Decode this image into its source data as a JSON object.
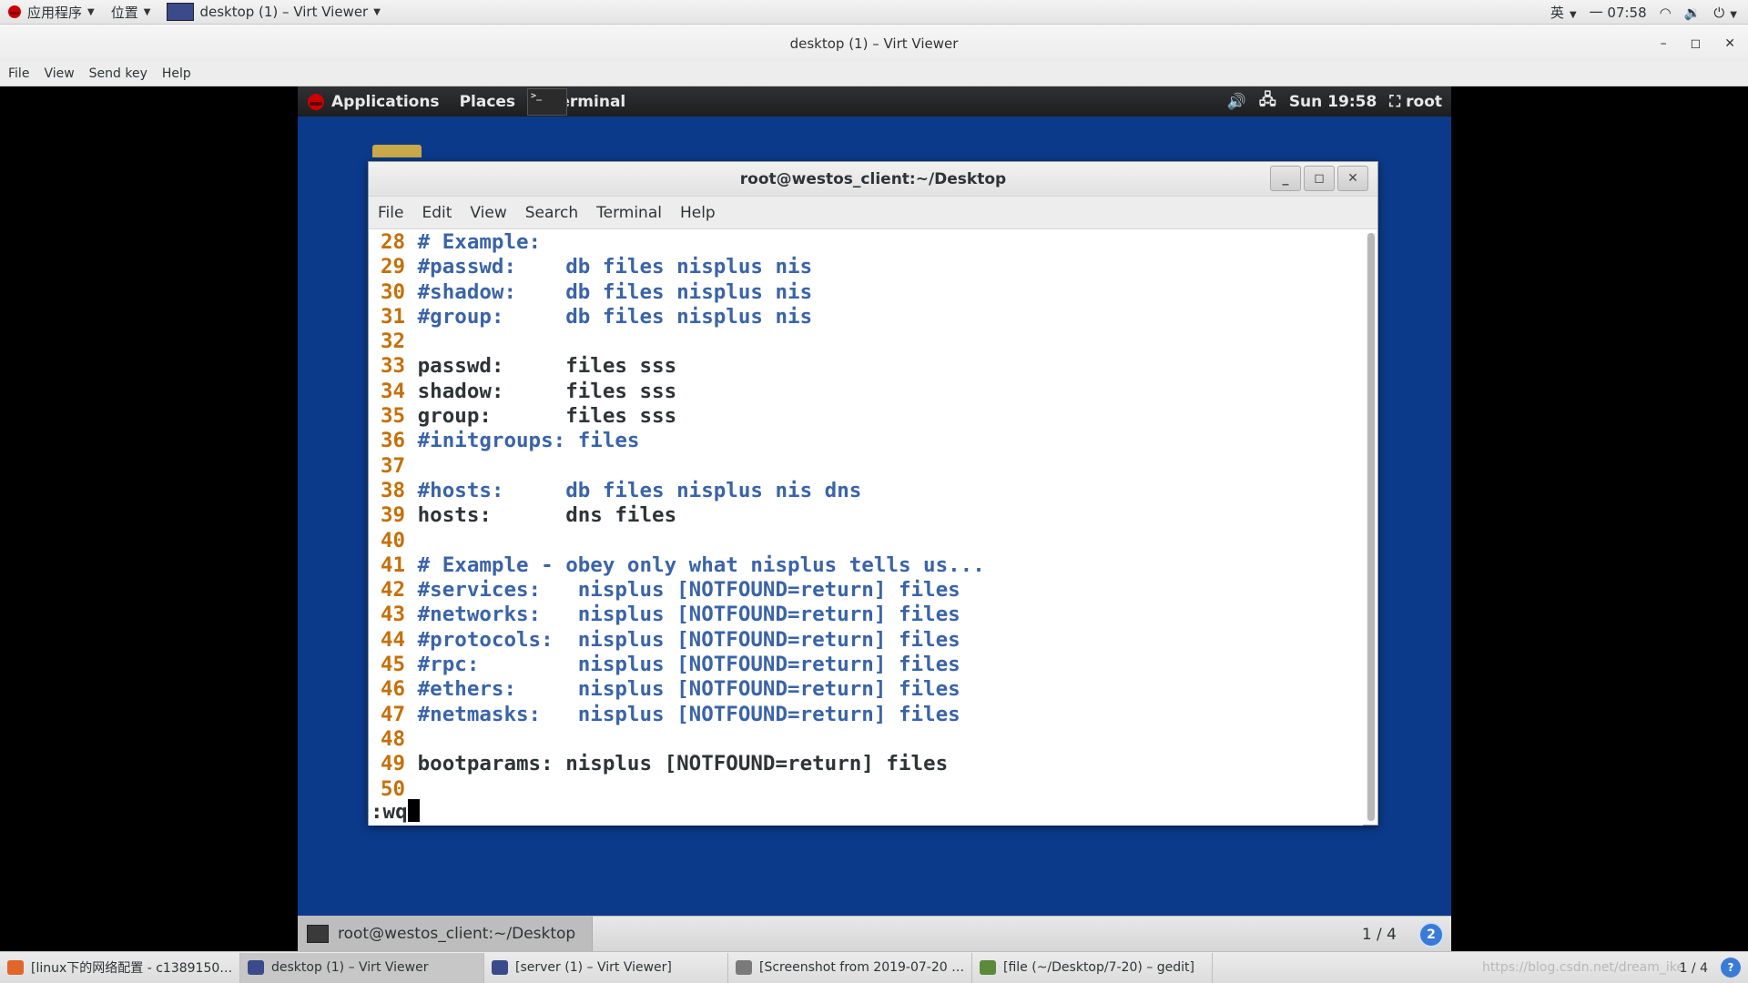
{
  "host_panel": {
    "applications": "应用程序",
    "places": "位置",
    "window_title": "desktop (1) – Virt Viewer",
    "input_method": "英",
    "clock": "一 07:58"
  },
  "virt_viewer": {
    "title": "desktop (1) – Virt Viewer",
    "menu": [
      "File",
      "View",
      "Send key",
      "Help"
    ]
  },
  "guest_panel": {
    "applications": "Applications",
    "places": "Places",
    "terminal": "Terminal",
    "clock": "Sun 19:58",
    "user": "root"
  },
  "terminal": {
    "title": "root@westos_client:~/Desktop",
    "menu": [
      "File",
      "Edit",
      "View",
      "Search",
      "Terminal",
      "Help"
    ],
    "lines": [
      {
        "n": "28",
        "text": "# Example:",
        "comment": true
      },
      {
        "n": "29",
        "text": "#passwd:    db files nisplus nis",
        "comment": true
      },
      {
        "n": "30",
        "text": "#shadow:    db files nisplus nis",
        "comment": true
      },
      {
        "n": "31",
        "text": "#group:     db files nisplus nis",
        "comment": true
      },
      {
        "n": "32",
        "text": "",
        "comment": false
      },
      {
        "n": "33",
        "text": "passwd:     files sss",
        "comment": false
      },
      {
        "n": "34",
        "text": "shadow:     files sss",
        "comment": false
      },
      {
        "n": "35",
        "text": "group:      files sss",
        "comment": false
      },
      {
        "n": "36",
        "text": "#initgroups: files",
        "comment": true
      },
      {
        "n": "37",
        "text": "",
        "comment": false
      },
      {
        "n": "38",
        "text": "#hosts:     db files nisplus nis dns",
        "comment": true
      },
      {
        "n": "39",
        "text": "hosts:      dns files",
        "comment": false
      },
      {
        "n": "40",
        "text": "",
        "comment": false
      },
      {
        "n": "41",
        "text": "# Example - obey only what nisplus tells us...",
        "comment": true
      },
      {
        "n": "42",
        "text": "#services:   nisplus [NOTFOUND=return] files",
        "comment": true
      },
      {
        "n": "43",
        "text": "#networks:   nisplus [NOTFOUND=return] files",
        "comment": true
      },
      {
        "n": "44",
        "text": "#protocols:  nisplus [NOTFOUND=return] files",
        "comment": true
      },
      {
        "n": "45",
        "text": "#rpc:        nisplus [NOTFOUND=return] files",
        "comment": true
      },
      {
        "n": "46",
        "text": "#ethers:     nisplus [NOTFOUND=return] files",
        "comment": true
      },
      {
        "n": "47",
        "text": "#netmasks:   nisplus [NOTFOUND=return] files",
        "comment": true
      },
      {
        "n": "48",
        "text": "",
        "comment": false
      },
      {
        "n": "49",
        "text": "bootparams: nisplus [NOTFOUND=return] files",
        "comment": false
      },
      {
        "n": "50",
        "text": "",
        "comment": false
      }
    ],
    "command": ":wq"
  },
  "guest_taskbar": {
    "task": "root@westos_client:~/Desktop",
    "pager": "1 / 4",
    "notifications": "2"
  },
  "host_taskbar": {
    "items": [
      {
        "label": "[linux下的网络配置 - c1389150…",
        "icon_color": "#e0662a",
        "active": false
      },
      {
        "label": "desktop (1) – Virt Viewer",
        "icon_color": "#3a4a8a",
        "active": true
      },
      {
        "label": "[server (1) – Virt Viewer]",
        "icon_color": "#3a4a8a",
        "active": false
      },
      {
        "label": "[Screenshot from 2019-07-20 …",
        "icon_color": "#7a7a7a",
        "active": false
      },
      {
        "label": "[file (~/Desktop/7-20) – gedit]",
        "icon_color": "#5a8a3a",
        "active": false
      }
    ],
    "pager": "1 / 4",
    "watermark": "https://blog.csdn.net/dream_ike"
  },
  "colors": {
    "guest_background": "#0b3a8a",
    "line_number": "#c4700a",
    "comment": "#3a64a8"
  }
}
